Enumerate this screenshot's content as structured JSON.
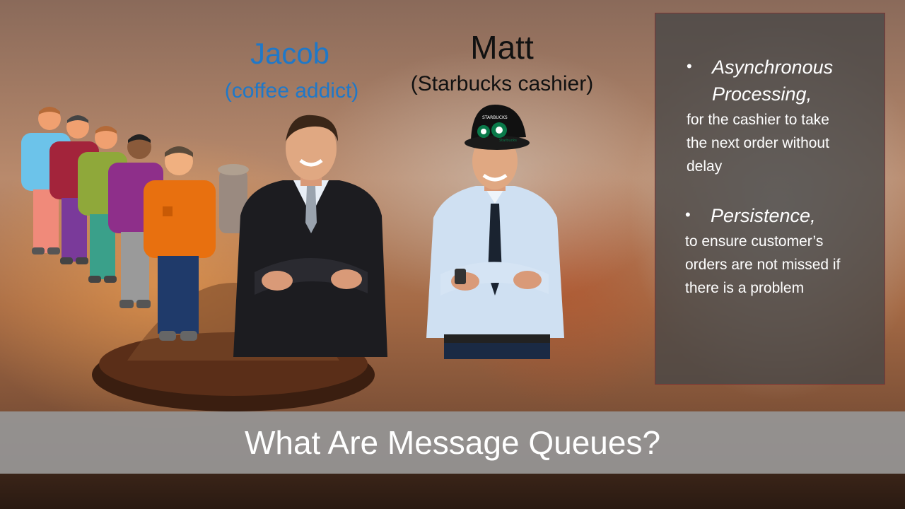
{
  "slide": {
    "title": "What Are Message Queues?"
  },
  "characters": {
    "jacob": {
      "name": "Jacob",
      "role": "(coffee addict)",
      "color": "#1f78c8"
    },
    "matt": {
      "name": "Matt",
      "role": "(Starbucks cashier)",
      "cap_text": "STARBUCKS",
      "cap_logo_text": "Starbucks"
    }
  },
  "panel": {
    "bullets": [
      {
        "heading_line1": "Asynchronous",
        "heading_line2": "Processing,",
        "lines": [
          "for the cashier to take",
          "the next order without",
          "delay"
        ]
      },
      {
        "heading_line1": "Persistence,",
        "lines": [
          "to ensure customer’s",
          "orders are not missed if",
          "there is a problem"
        ]
      }
    ]
  },
  "queue_people_colors": [
    "#6cc3ea",
    "#a3243b",
    "#8fa83a",
    "#8e2f8a",
    "#e8700f"
  ]
}
